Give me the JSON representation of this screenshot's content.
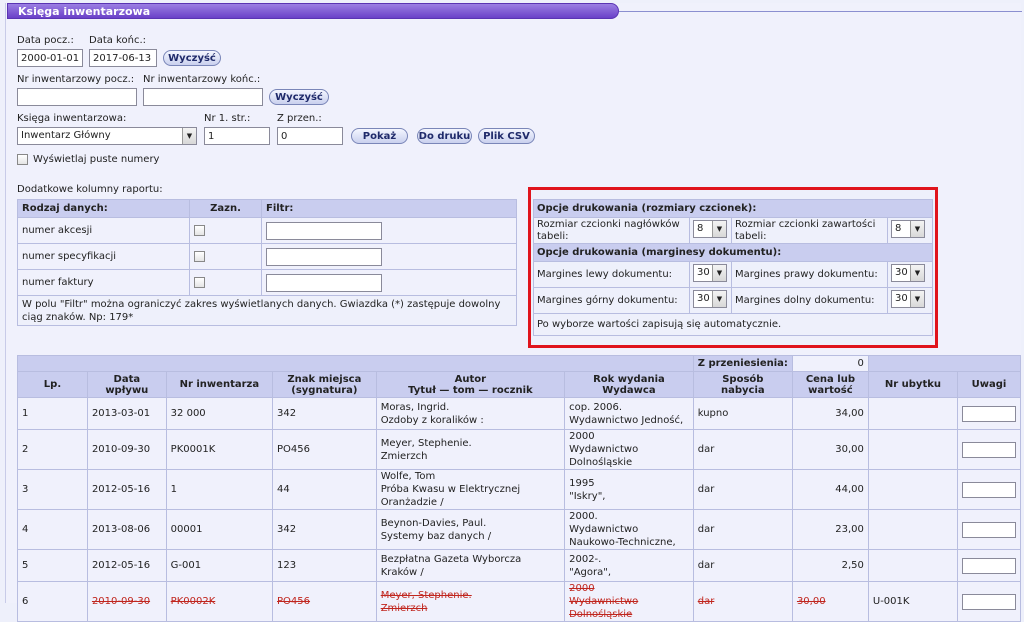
{
  "window": {
    "title": "Księga inwentarzowa"
  },
  "dates": {
    "from_label": "Data pocz.:",
    "from_value": "2000-01-01",
    "to_label": "Data końc.:",
    "to_value": "2017-06-13",
    "clear_label": "Wyczyść"
  },
  "inventory_range": {
    "from_label": "Nr inwentarzowy pocz.:",
    "from_value": "",
    "to_label": "Nr inwentarzowy końc.:",
    "to_value": "",
    "clear_label": "Wyczyść"
  },
  "book": {
    "label": "Księga inwentarzowa:",
    "selected": "Inwentarz Główny",
    "page_label": "Nr 1. str.:",
    "page_value": "1",
    "carry_label": "Z przen.:",
    "carry_value": "0",
    "show_label": "Pokaż",
    "print_label": "Do druku",
    "csv_label": "Plik CSV"
  },
  "empty_numbers": {
    "label": "Wyświetlaj puste numery"
  },
  "extra_columns": {
    "caption": "Dodatkowe kolumny raportu:",
    "headers": [
      "Rodzaj danych:",
      "Zazn.",
      "Filtr:"
    ],
    "rows": [
      {
        "name": "numer akcesji",
        "filter": ""
      },
      {
        "name": "numer specyfikacji",
        "filter": ""
      },
      {
        "name": "numer faktury",
        "filter": ""
      }
    ],
    "note": "W polu \"Filtr\" można ograniczyć zakres wyświetlanych danych. Gwiazdka (*) zastępuje dowolny ciąg znaków. Np: 179*"
  },
  "print_options": {
    "fonts_header": "Opcje drukowania (rozmiary czcionek):",
    "header_font_label": "Rozmiar czcionki nagłówków tabeli:",
    "header_font_value": "8",
    "content_font_label": "Rozmiar czcionki zawartości tabeli:",
    "content_font_value": "8",
    "margins_header": "Opcje drukowania (marginesy dokumentu):",
    "left_label": "Margines lewy dokumentu:",
    "left_value": "30",
    "right_label": "Margines prawy dokumentu:",
    "right_value": "30",
    "top_label": "Margines górny dokumentu:",
    "top_value": "30",
    "bottom_label": "Margines dolny dokumentu:",
    "bottom_value": "30",
    "autosave_note": "Po wyborze wartości zapisują się automatycznie."
  },
  "table": {
    "carry_label": "Z przeniesienia:",
    "carry_value": "0",
    "headers": {
      "lp": "Lp.",
      "date": "Data wpływu",
      "inv": "Nr inwentarza",
      "sign1": "Znak miejsca",
      "sign2": "(sygnatura)",
      "author1": "Autor",
      "author2": "Tytuł — tom — rocznik",
      "year1": "Rok wydania",
      "year2": "Wydawca",
      "acq1": "Sposób",
      "acq2": "nabycia",
      "price1": "Cena lub",
      "price2": "wartość",
      "loss": "Nr ubytku",
      "notes": "Uwagi"
    },
    "rows": [
      {
        "lp": "1",
        "date": "2013-03-01",
        "inv": "32 000",
        "sign": "342",
        "author": "Moras, Ingrid.",
        "title": "Ozdoby z koralików :",
        "year": "cop. 2006.",
        "publisher": "Wydawnictwo Jedność,",
        "acq": "kupno",
        "price": "34,00",
        "loss": ""
      },
      {
        "lp": "2",
        "date": "2010-09-30",
        "inv": "PK0001K",
        "sign": "PO456",
        "author": "Meyer, Stephenie.",
        "title": "Zmierzch",
        "year": "2000",
        "publisher": "Wydawnictwo Dolnośląskie",
        "acq": "dar",
        "price": "30,00",
        "loss": ""
      },
      {
        "lp": "3",
        "date": "2012-05-16",
        "inv": "1",
        "sign": "44",
        "author": "Wolfe, Tom",
        "title": "Próba Kwasu w Elektrycznej Oranżadzie /",
        "year": "1995",
        "publisher": "\"Iskry\",",
        "acq": "dar",
        "price": "44,00",
        "loss": ""
      },
      {
        "lp": "4",
        "date": "2013-08-06",
        "inv": "00001",
        "sign": "342",
        "author": "Beynon-Davies, Paul.",
        "title": "Systemy baz danych /",
        "year": "2000.",
        "publisher": "Wydawnictwo Naukowo-Techniczne,",
        "acq": "dar",
        "price": "23,00",
        "loss": ""
      },
      {
        "lp": "5",
        "date": "2012-05-16",
        "inv": "G-001",
        "sign": "123",
        "author": "Bezpłatna Gazeta Wyborcza Kraków /",
        "title": "",
        "year": "2002-.",
        "publisher": "\"Agora\",",
        "acq": "dar",
        "price": "2,50",
        "loss": ""
      },
      {
        "lp": "6",
        "date": "2010-09-30",
        "inv": "PK0002K",
        "sign": "PO456",
        "author": "Meyer, Stephenie.",
        "title": "Zmierzch",
        "year": "2000",
        "publisher": "Wydawnictwo Dolnośląskie",
        "acq": "dar",
        "price": "30,00",
        "loss": "U-001K"
      }
    ]
  }
}
